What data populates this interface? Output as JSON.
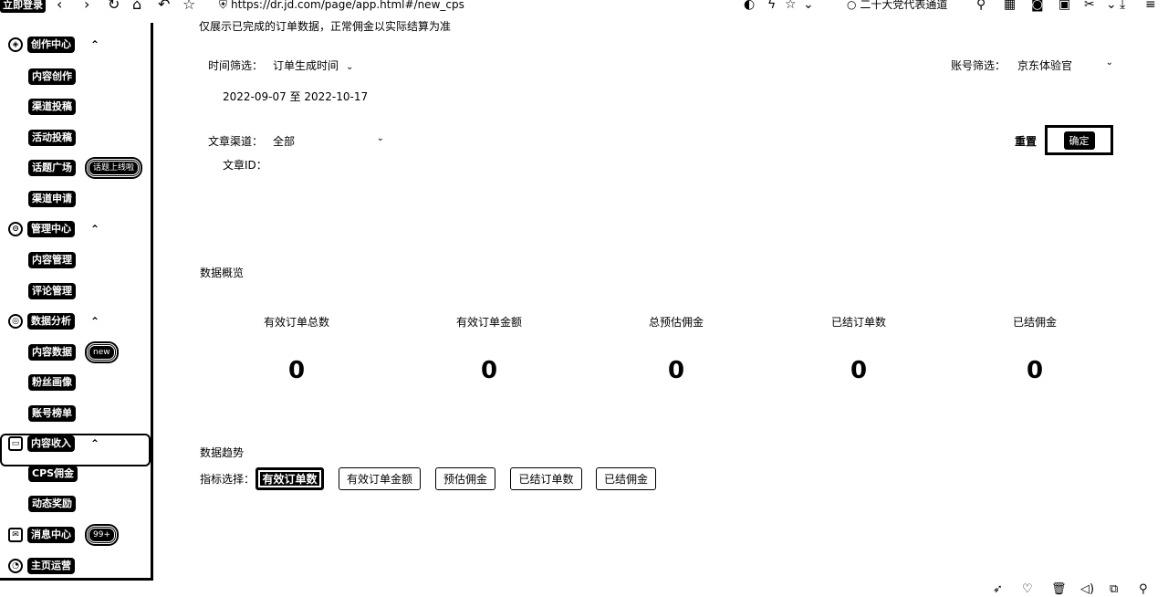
{
  "browser": {
    "tab_label": "立即登录",
    "url": "https://dr.jd.com/page/app.html#/new_cps",
    "search_query": "二十大党代表通道",
    "icons": [
      "back-icon",
      "forward-icon",
      "refresh-icon",
      "home-icon",
      "undo-icon",
      "star-icon",
      "security-shield-icon"
    ]
  },
  "sidebar": {
    "categories": [
      {
        "label": "创作中心",
        "icon": "create-icon"
      },
      {
        "label": "管理中心",
        "icon": "manage-icon"
      },
      {
        "label": "数据分析",
        "icon": "analytics-icon"
      },
      {
        "label": "内容收入",
        "icon": "income-icon"
      },
      {
        "label": "消息中心",
        "icon": "message-icon"
      },
      {
        "label": "主页运营",
        "icon": "homepage-icon"
      }
    ],
    "items": [
      {
        "label": "内容创作"
      },
      {
        "label": "渠道投稿"
      },
      {
        "label": "活动投稿"
      },
      {
        "label": "话题广场",
        "badge": "话题上线啦"
      },
      {
        "label": "渠道申请"
      },
      {
        "label": "内容管理"
      },
      {
        "label": "评论管理"
      },
      {
        "label": "内容数据",
        "badge": "new"
      },
      {
        "label": "粉丝画像"
      },
      {
        "label": "账号榜单"
      },
      {
        "label": "CPS佣金"
      },
      {
        "label": "动态奖励"
      }
    ],
    "message_badge": "99+"
  },
  "main": {
    "notice": "仅展示已完成的订单数据，正常佣金以实际结算为准",
    "time_filter_label": "时间筛选：",
    "time_filter_value": "订单生成时间",
    "date_range": "2022-09-07 至 2022-10-17",
    "account_label": "账号筛选：",
    "account_value": "京东体验官",
    "channel_label": "文章渠道：",
    "channel_value": "全部",
    "article_id_label": "文章ID：",
    "reset_label": "重置",
    "confirm_label": "确定",
    "overview_title": "数据概览",
    "metrics": [
      {
        "label": "有效订单总数",
        "value": "0"
      },
      {
        "label": "有效订单金额",
        "value": "0"
      },
      {
        "label": "总预估佣金",
        "value": "0"
      },
      {
        "label": "已结订单数",
        "value": "0"
      },
      {
        "label": "已结佣金",
        "value": "0"
      }
    ],
    "trend_title": "数据趋势",
    "indicator_label": "指标选择：",
    "indicators": [
      {
        "label": "有效订单数",
        "active": true
      },
      {
        "label": "有效订单金额",
        "active": false
      },
      {
        "label": "预估佣金",
        "active": false
      },
      {
        "label": "已结订单数",
        "active": false
      },
      {
        "label": "已结佣金",
        "active": false
      }
    ]
  }
}
